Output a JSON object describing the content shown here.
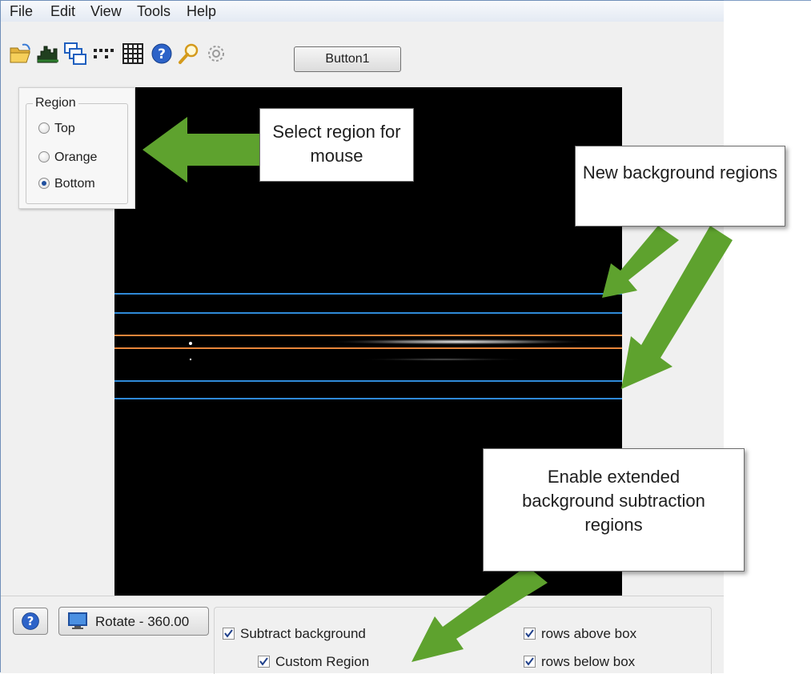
{
  "menu": [
    "File",
    "Edit",
    "View",
    "Tools",
    "Help"
  ],
  "toolbar": {
    "icons": [
      "open-folder-icon",
      "histogram-icon",
      "windows-icon",
      "dots-icon",
      "grid-icon",
      "help-icon",
      "magnifier-icon",
      "gear-icon"
    ],
    "button1_label": "Button1"
  },
  "region": {
    "legend": "Region",
    "options": [
      "Top",
      "Orange",
      "Bottom"
    ],
    "selected": "Bottom"
  },
  "callouts": {
    "select_region": "Select region for mouse",
    "new_background": "New background regions",
    "enable_extended": "Enable extended background subtraction regions"
  },
  "bottom": {
    "rotate_label": "Rotate - 360.00",
    "subtract_background": "Subtract background",
    "custom_region": "Custom Region",
    "rows_above": "rows above box",
    "rows_below": "rows below box"
  },
  "colors": {
    "blue_line": "#2f8ad8",
    "orange_line": "#e8863a",
    "arrow_green": "#5ea22e",
    "image_background": "#000000"
  }
}
